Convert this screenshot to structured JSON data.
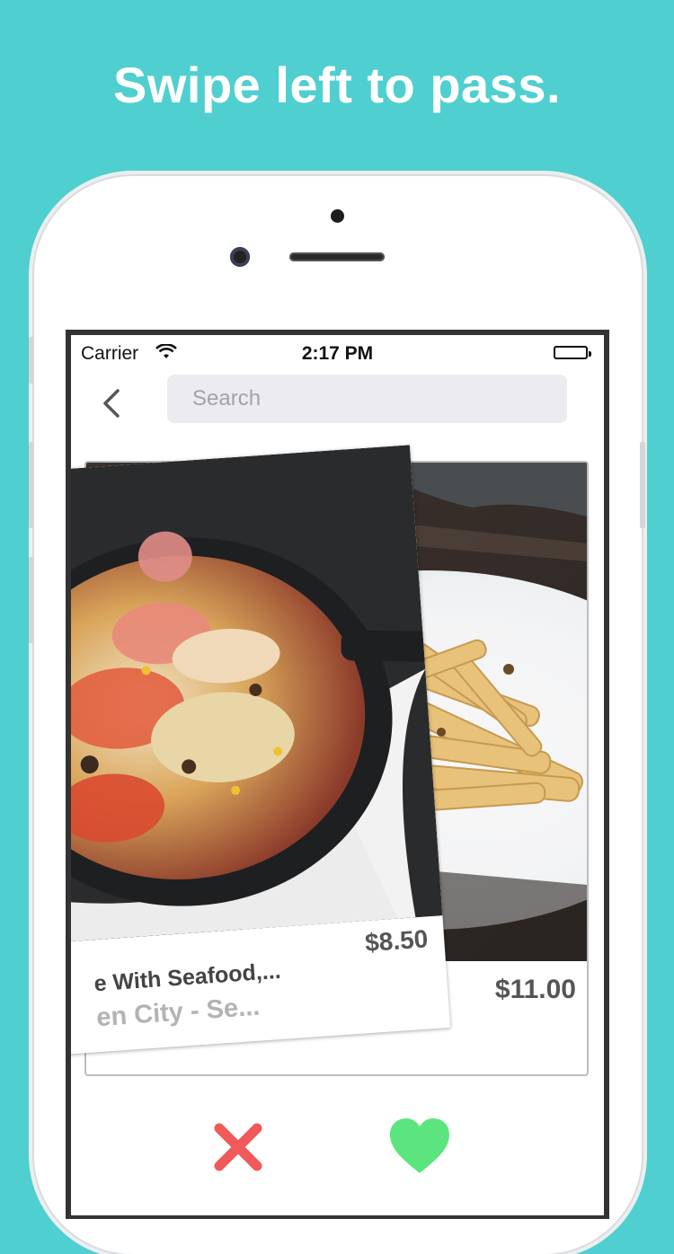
{
  "headline": "Swipe left to pass.",
  "status_bar": {
    "carrier": "Carrier",
    "time": "2:17 PM",
    "wifi_icon": "wifi-icon",
    "battery_icon": "battery-icon"
  },
  "nav": {
    "back_icon": "chevron-left-icon",
    "search_placeholder": "Search"
  },
  "cards": {
    "front": {
      "title": "e With Seafood,...",
      "subtitle": "en City - Se...",
      "price": "$8.50"
    },
    "back": {
      "price": "$11.00"
    }
  },
  "actions": {
    "pass_icon": "close-x-icon",
    "like_icon": "heart-icon",
    "pass_color": "#f05a5a",
    "like_color": "#5ce57f"
  },
  "colors": {
    "background": "#4fcfcf"
  }
}
